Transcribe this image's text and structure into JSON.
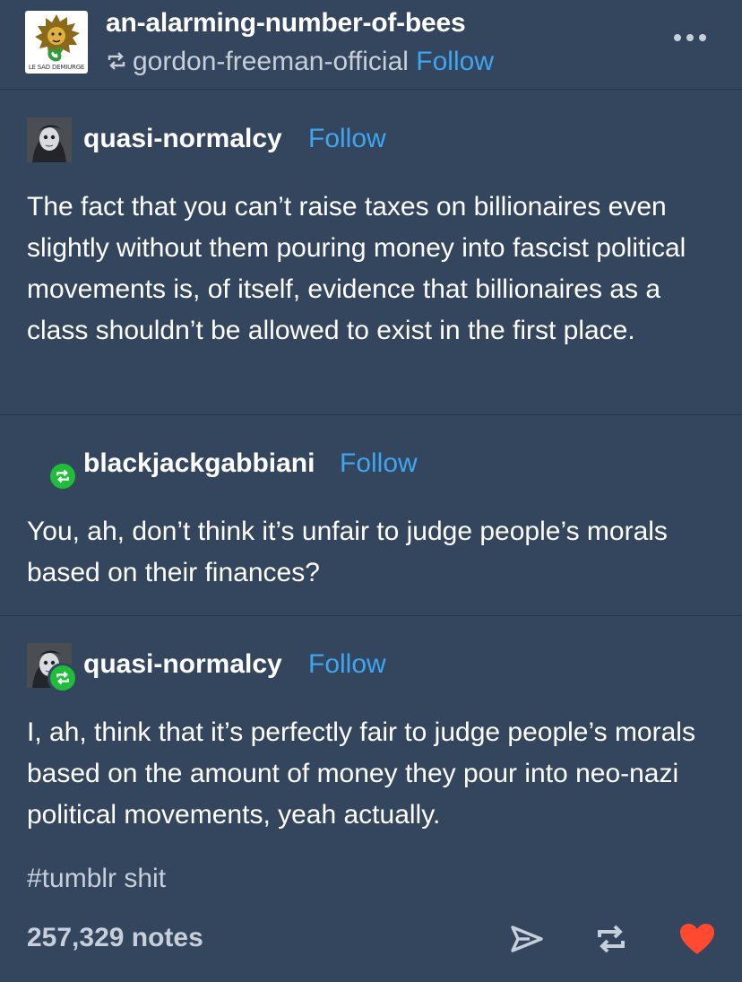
{
  "header": {
    "blog_name": "an-alarming-number-of-bees",
    "avatar_caption": "LE SAD DEMIURGE",
    "reblogged_from": "gordon-freeman-official",
    "follow_label": "Follow",
    "more_icon": "more-dots-icon"
  },
  "trail": [
    {
      "username": "quasi-normalcy",
      "follow_label": "Follow",
      "text": "The fact that you can’t raise taxes on billionaires even slightly without them pouring money into fascist political movements is, of itself, evidence that billionaires as a class shouldn’t be allowed to exist in the first place."
    },
    {
      "username": "blackjackgabbiani",
      "follow_label": "Follow",
      "text": "You, ah, don’t think it’s unfair to judge people’s morals based on their finances?"
    },
    {
      "username": "quasi-normalcy",
      "follow_label": "Follow",
      "text": "I, ah, think that it’s perfectly fair to judge people’s morals based on the amount of money they pour into neo-nazi political movements, yeah actually."
    }
  ],
  "tags": "#tumblr shit",
  "footer": {
    "notes": "257,329 notes",
    "actions": [
      "share-icon",
      "reblog-icon",
      "heart-icon"
    ]
  },
  "colors": {
    "background": "#34455e",
    "link": "#3ea6f0",
    "reblog_green": "#1fbd3a",
    "heart_red": "#ff4930",
    "muted_text": "#c7cfda"
  }
}
